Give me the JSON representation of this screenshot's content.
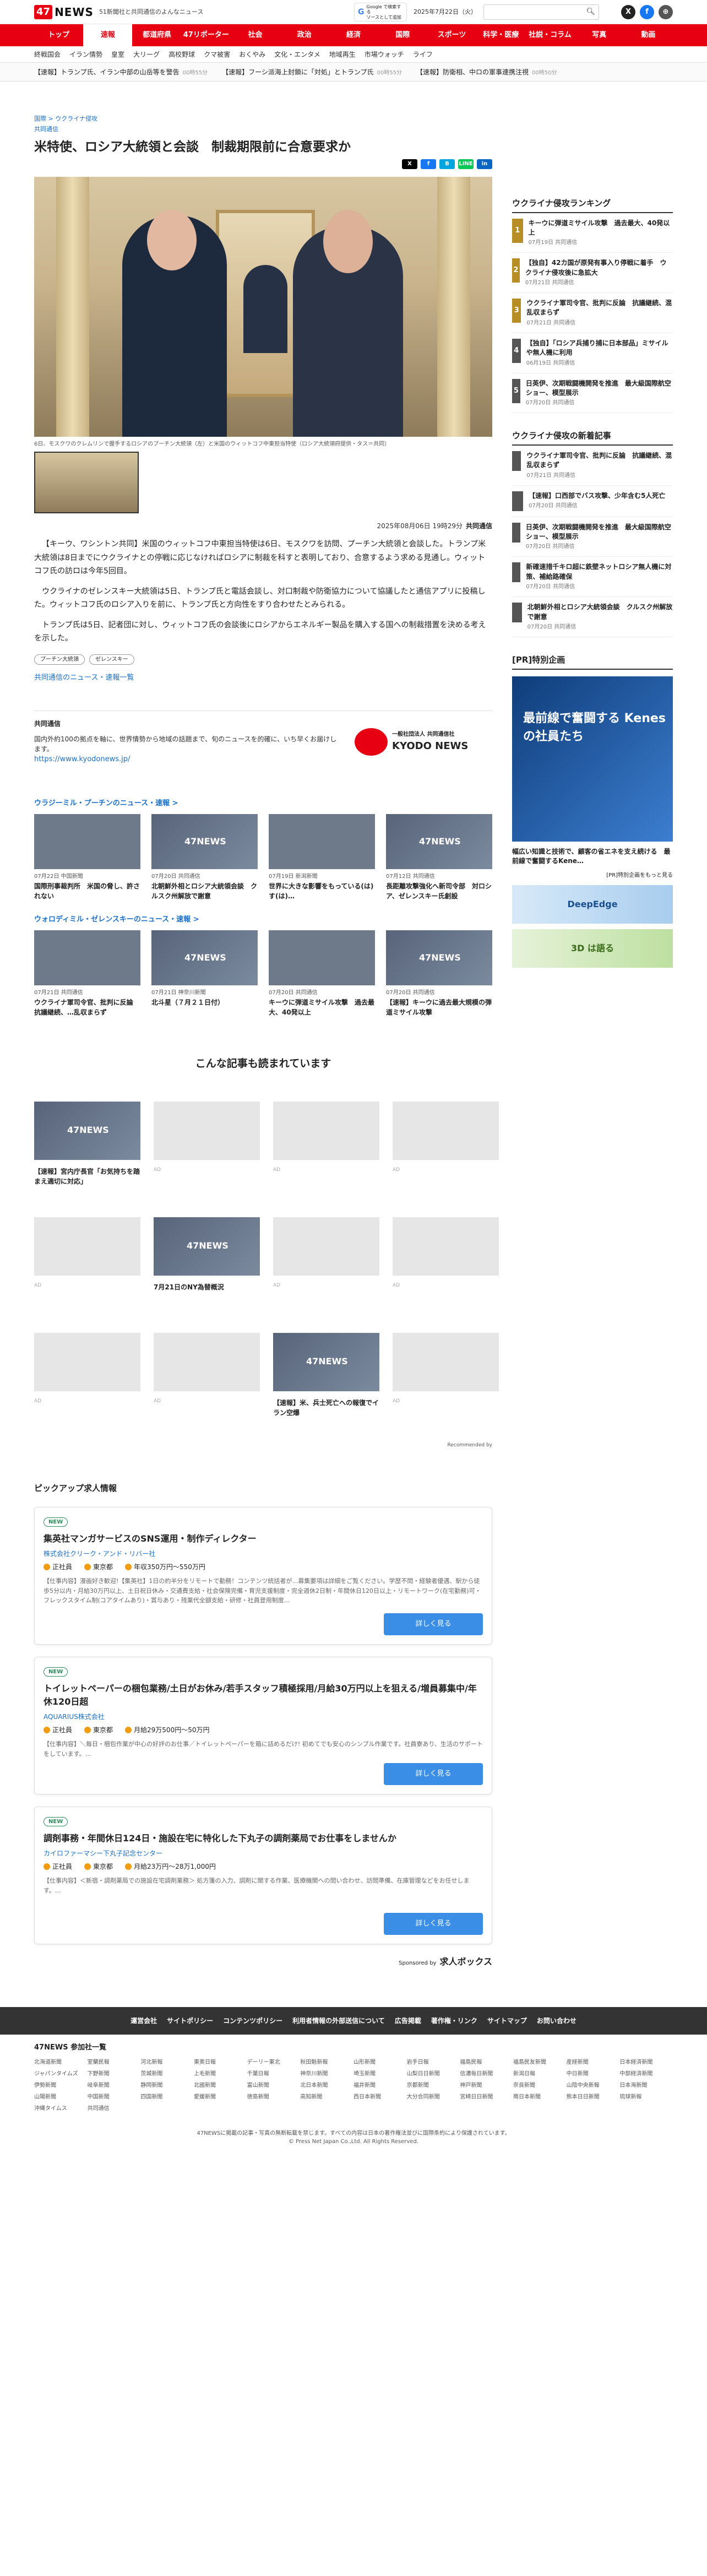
{
  "header": {
    "logo_num": "47",
    "logo_word": "NEWS",
    "tagline": "51新聞社と共同通信のよんなニュース",
    "google_badge_l1": "Google で検索する",
    "google_badge_l2": "ソースとして追加",
    "date": "2025年7月22日（火）",
    "social": [
      "X",
      "f",
      "⊕"
    ]
  },
  "nav": [
    "トップ",
    "速報",
    "都道府県",
    "47リポーターズ",
    "社会",
    "政治",
    "経済",
    "国際",
    "スポーツ",
    "科学・医療",
    "社説・コラム",
    "写真",
    "動画"
  ],
  "subnav": [
    "終戦国会",
    "イラン情勢",
    "皇室",
    "大リーグ",
    "高校野球",
    "クマ被害",
    "おくやみ",
    "文化・エンタメ",
    "地域再生",
    "市場ウォッチ",
    "ライフ"
  ],
  "ticker": [
    {
      "text": "【速報】トランプ氏、イラン中部の山岳等を警告",
      "time": "00時55分"
    },
    {
      "text": "【速報】フーシ派海上封鎖に「対処」とトランプ氏",
      "time": "00時55分"
    },
    {
      "text": "【速報】防衛相、中ロの軍事連携注視",
      "time": "00時50分"
    }
  ],
  "article": {
    "crumb": "国際 > ウクライナ侵攻",
    "crumb2": "共同通信",
    "title": "米特使、ロシア大統領と会談　制裁期限前に合意要求か",
    "share": [
      "X",
      "f",
      "B",
      "LINE",
      "in"
    ],
    "caption": "6日、モスクワのクレムリンで握手するロシアのプーチン大統領（左）と米国のウィットコフ中東担当特使（ロシア大統領府提供・タス＝共同）",
    "datetime": "2025年08月06日 19時29分",
    "source": "共同通信",
    "paras": [
      "【キーウ、ワシントン共同】米国のウィットコフ中東担当特使は6日、モスクワを訪問、プーチン大統領と会談した。トランプ米大統領は8日までにウクライナとの停戦に応じなければロシアに制裁を科すと表明しており、合意するよう求める見通し。ウィットコフ氏の訪ロは今年5回目。",
      "ウクライナのゼレンスキー大統領は5日、トランプ氏と電話会談し、対口制裁や防衛協力について協議したと通信アプリに投稿した。ウィットコフ氏のロシア入りを前に、トランプ氏と方向性をすり合わせたとみられる。",
      "トランプ氏は5日、記者団に対し、ウィットコフ氏の会談後にロシアからエネルギー製品を購入する国への制裁措置を決める考えを示した。"
    ],
    "tags": [
      "プーチン大統領",
      "ゼレンスキー"
    ],
    "more": "共同通信のニュース・速報一覧"
  },
  "kyodo": {
    "label": "共同通信",
    "desc": "国内外約100の拠点を軸に、世界情勢から地域の話題まで、旬のニュースを的確に、いち早くお届けします。",
    "url": "https://www.kyodonews.jp/",
    "logo_l1": "一般社団法人 共同通信社",
    "logo_l2": "KYODO NEWS"
  },
  "sec1": {
    "title": "ウラジーミル・プーチンのニュース・速報 >",
    "cards": [
      {
        "meta": "07月22日 中国新聞",
        "title": "国際刑事裁判所　米国の脅し、許されない"
      },
      {
        "meta": "07月20日 共同通信",
        "title": "北朝鮮外相とロシア大統領会談　クルスク州解放で謝意"
      },
      {
        "meta": "07月19日 新潟新聞",
        "title": "世界に大きな影響をもっている(は)す(は)…"
      },
      {
        "meta": "07月12日 共同通信",
        "title": "長距離攻撃強化へ新司令部　対ロシア、ゼレンスキー氏創設"
      }
    ]
  },
  "sec2": {
    "title": "ウォロディミル・ゼレンスキーのニュース・速報 >",
    "cards": [
      {
        "meta": "07月21日 共同通信",
        "title": "ウクライナ軍司令官、批判に反論　抗議継続、…乱収まらず"
      },
      {
        "meta": "07月21日 神奈川新聞",
        "title": "北斗星（７月２１日付）"
      },
      {
        "meta": "07月20日 共同通信",
        "title": "キーウに弾道ミサイル攻撃　過去最大、40発以上"
      },
      {
        "meta": "07月20日 共同通信",
        "title": "【速報】キーウに過去最大規模の弾道ミサイル攻撃"
      }
    ]
  },
  "popular": {
    "title": "こんな記事も読まれています",
    "items": [
      {
        "title": "【速報】宮内庁長官「お気持ちを踏まえ適切に対応」",
        "ad": ""
      },
      {
        "title": "",
        "ad": "AD"
      },
      {
        "title": "",
        "ad": "AD"
      },
      {
        "title": "",
        "ad": "AD"
      },
      {
        "title": "",
        "ad": "AD"
      },
      {
        "title": "7月21日のNY為替概況",
        "ad": ""
      },
      {
        "title": "",
        "ad": "AD"
      },
      {
        "title": "",
        "ad": "AD"
      },
      {
        "title": "",
        "ad": "AD"
      },
      {
        "title": "",
        "ad": "AD"
      },
      {
        "title": "【速報】米、兵士死亡への報復でイラン空爆",
        "ad": ""
      },
      {
        "title": "",
        "ad": "AD"
      }
    ],
    "rec": "Recommended by"
  },
  "pickup": {
    "title": "ピックアップ求人情報",
    "jobs": [
      {
        "badge": "NEW",
        "title": "集英社マンガサービスのSNS運用・制作ディレクター",
        "company": "株式会社クリーク・アンド・リバー社",
        "type": "正社員",
        "place": "東京都",
        "pay": "年収350万円〜550万円",
        "desc": "【仕事内容】漫画好き歓迎!【集英社】1日の約半分をリモートで勤務！コンテンツ統括者が…募集要項は詳細をご覧ください。学歴不問・経験者優遇、駅から徒歩5分以内・月給30万円以上、土日祝日休み・交通費支給・社会保険完備・育児支援制度・完全週休2日制・年間休日120日以上・リモートワーク(在宅勤務)可・フレックスタイム制(コアタイムあり)・賞与あり・残業代全額支給・研修・社員登用制度…"
      },
      {
        "badge": "NEW",
        "title": "トイレットペーパーの梱包業務/土日がお休み/若手スタッフ積極採用/月給30万円以上を狙える/増員募集中/年休120日超",
        "company": "AQUARIUS株式会社",
        "type": "正社員",
        "place": "東京都",
        "pay": "月給29万500円〜50万円",
        "desc": "【仕事内容】＼毎日・梱包作業が中心の好評のお仕事／トイレットペーパーを箱に詰めるだけ! 初めてでも安心のシンプル作業です。社員寮あり、生活のサポートをしています。…"
      },
      {
        "badge": "NEW",
        "title": "調剤事務・年間休日124日・施設在宅に特化した下丸子の調剤薬局でお仕事をしませんか",
        "company": "カイロファーマシー下丸子記念センター",
        "type": "正社員",
        "place": "東京都",
        "pay": "月給23万円〜28万1,000円",
        "desc": "【仕事内容】＜新宿・調剤薬局での施設在宅調剤業務＞ 処方箋の入力、調剤に関する作業、医療機関への問い合わせ、訪問準備、在庫管理などをお任せします。…"
      }
    ],
    "btn": "詳しく見る",
    "sponsor": "Sponsored by",
    "sponsor_name": "求人ボックス"
  },
  "side": {
    "ranking_title": "ウクライナ侵攻ランキング",
    "ranking": [
      {
        "n": "1",
        "t": "キーウに弾道ミサイル攻撃　過去最大、40発以上",
        "d": "07月19日 共同通信"
      },
      {
        "n": "2",
        "t": "【独自】42カ国が原発有事入り停戦に着手　ウクライナ侵攻後に急拡大",
        "d": "07月21日 共同通信"
      },
      {
        "n": "3",
        "t": "ウクライナ軍司令官、批判に反論　抗議継続、混乱収まらず",
        "d": "07月21日 共同通信"
      },
      {
        "n": "4",
        "t": "【独自】「ロシア兵捕り捕に日本部品」ミサイルや無人機に利用",
        "d": "06月19日 共同通信"
      },
      {
        "n": "5",
        "t": "日英伊、次期戦闘機開発を推進　最大級国際航空ショー、模型展示",
        "d": "07月20日 共同通信"
      }
    ],
    "latest_title": "ウクライナ侵攻の新着記事",
    "latest": [
      {
        "t": "ウクライナ軍司令官、批判に反論　抗議継続、混乱収まらず",
        "d": "07月21日 共同通信"
      },
      {
        "t": "【速報】口西部でバス攻撃、少年含む5人死亡",
        "d": "07月20日 共同通信"
      },
      {
        "t": "日英伊、次期戦闘機開発を推進　最大級国際航空ショー、模型展示",
        "d": "07月20日 共同通信"
      },
      {
        "t": "新確速措千キロ超に鉄壁ネットロシア無人機に対策、補給路確保",
        "d": "07月20日 共同通信"
      },
      {
        "t": "北朝鮮外相とロシア大統領会談　クルスク州解放で謝意",
        "d": "07月20日 共同通信"
      }
    ],
    "pr_title": "[PR]特別企画",
    "pr_ad": "最前線で奮闘する Kenes の社員たち",
    "pr_text1": "幅広い知識と技術で、顧客の省エネを支え続ける　最前線で奮闘するKene…",
    "pr_link": "[PR]特別企画をもっと見る",
    "banner1": "DeepEdge",
    "banner2": "3D は語る"
  },
  "footer": {
    "links": [
      "運営会社",
      "サイトポリシー",
      "コンテンツポリシー",
      "利用者情報の外部送信について",
      "広告掲載",
      "著作権・リンク",
      "サイトマップ",
      "お問い合わせ"
    ],
    "members_title": "47NEWS 参加社一覧",
    "members": [
      "北海道新聞",
      "室蘭民報",
      "河北新報",
      "東奥日報",
      "デーリー東北",
      "秋田魁新報",
      "山形新聞",
      "岩手日報",
      "福島民報",
      "福島民友新聞",
      "産経新聞",
      "日本経済新聞",
      "ジャパンタイムズ",
      "下野新聞",
      "茨城新聞",
      "上毛新聞",
      "千葉日報",
      "神奈川新聞",
      "埼玉新聞",
      "山梨日日新聞",
      "信濃毎日新聞",
      "新潟日報",
      "中日新聞",
      "中部経済新聞",
      "伊勢新聞",
      "岐阜新聞",
      "静岡新聞",
      "北國新聞",
      "富山新聞",
      "北日本新聞",
      "福井新聞",
      "京都新聞",
      "神戸新聞",
      "奈良新聞",
      "山陰中央新報",
      "日本海新聞",
      "山陽新聞",
      "中国新聞",
      "四国新聞",
      "愛媛新聞",
      "徳島新聞",
      "高知新聞",
      "西日本新聞",
      "大分合同新聞",
      "宮崎日日新聞",
      "南日本新聞",
      "熊本日日新聞",
      "琉球新報",
      "沖縄タイムス",
      "共同通信"
    ],
    "copy1": "47NEWSに掲載の記事・写真の無断転載を禁じます。すべての内容は日本の著作権法並びに国際条約により保護されています。",
    "copy2": "© Press Net Japan Co.,Ltd. All Rights Reserved."
  }
}
